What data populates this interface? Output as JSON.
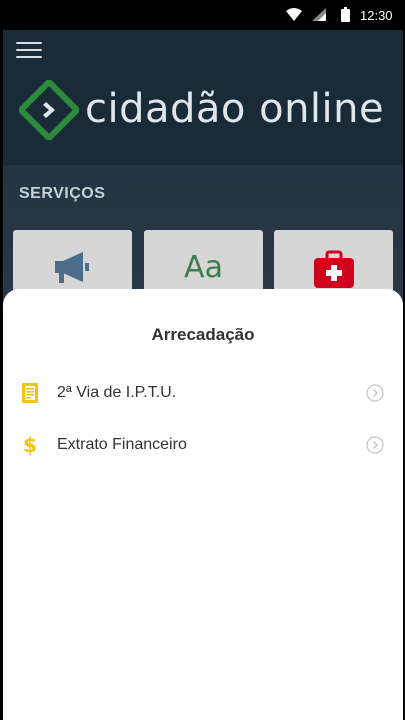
{
  "status_bar": {
    "time": "12:30"
  },
  "header": {
    "app_name": "cidadão online"
  },
  "services": {
    "title": "SERVIÇOS",
    "tiles": [
      {
        "icon": "megaphone-icon"
      },
      {
        "icon": "text-format-icon",
        "glyph": "Aa"
      },
      {
        "icon": "first-aid-kit-icon"
      }
    ]
  },
  "sheet": {
    "title": "Arrecadação",
    "items": [
      {
        "label": "2ª Via de I.P.T.U.",
        "icon": "document-icon"
      },
      {
        "label": "Extrato Financeiro",
        "icon": "dollar-icon",
        "glyph": "$"
      }
    ]
  },
  "colors": {
    "header_bg": "#1a2b38",
    "brand_green": "#2e8b3e",
    "accent_yellow": "#f1c40f",
    "tile_bg": "#d6d6d6",
    "aid_red": "#d0021b"
  }
}
